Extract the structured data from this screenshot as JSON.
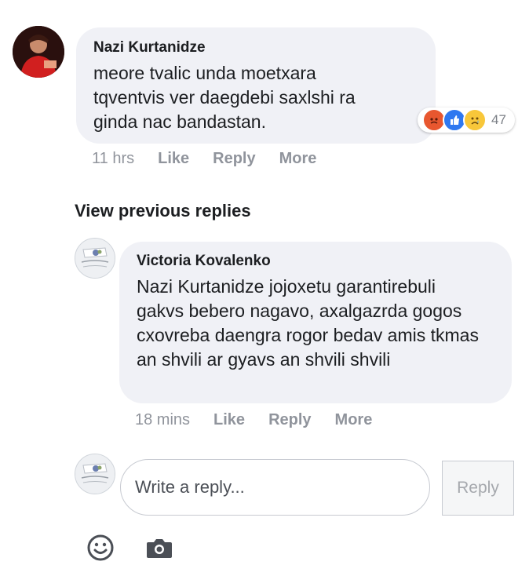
{
  "comment": {
    "author": "Nazi Kurtanidze",
    "text": "meore tvalic unda moetxara tqventvis ver daegdebi saxlshi ra ginda nac bandastan.",
    "reactions": {
      "count": "47",
      "types": [
        "angry-icon",
        "like-icon",
        "sad-icon"
      ]
    },
    "time": "11 hrs",
    "like_label": "Like",
    "reply_label": "Reply",
    "more_label": "More"
  },
  "view_previous": "View previous replies",
  "reply": {
    "author": "Victoria Kovalenko",
    "text": "Nazi Kurtanidze jojoxetu garantirebuli gakvs bebero nagavo, axalgazrda gogos cxovreba daengra rogor bedav amis tkmas an shvili ar gyavs an shvili shvili",
    "time": "18 mins",
    "like_label": "Like",
    "reply_label": "Reply",
    "more_label": "More"
  },
  "composer": {
    "placeholder": "Write a reply...",
    "submit_label": "Reply",
    "icons": [
      "smiley-icon",
      "camera-icon"
    ]
  },
  "colors": {
    "bubble": "#f0f1f6",
    "meta_text": "#90949c",
    "like_blue": "#2f78f0",
    "angry_orange": "#e8572f",
    "sad_yellow": "#f8c73a"
  }
}
